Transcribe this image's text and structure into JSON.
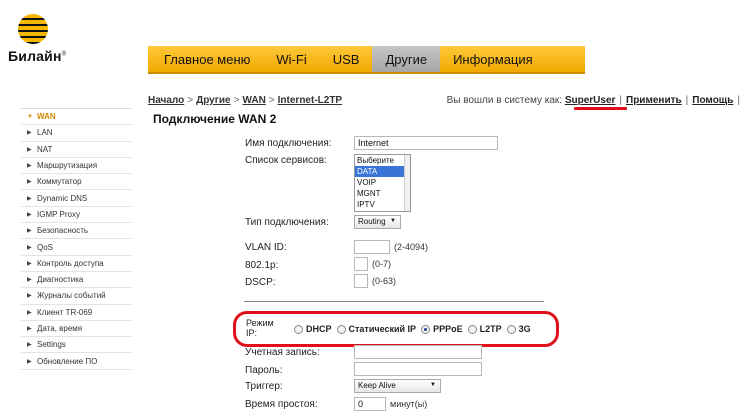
{
  "brand": {
    "logo_text": "Билайн",
    "trademark": "®"
  },
  "topnav": {
    "tabs": [
      {
        "label": "Главное меню"
      },
      {
        "label": "Wi-Fi"
      },
      {
        "label": "USB"
      },
      {
        "label": "Другие"
      },
      {
        "label": "Информация"
      }
    ],
    "active": "Другие"
  },
  "breadcrumb": [
    "Начало",
    "Другие",
    "WAN",
    "Internet-L2TP"
  ],
  "breadcrumb_sep": ">",
  "userline": {
    "prefix": "Вы вошли в систему как:",
    "user": "SuperUser",
    "apply": "Применить",
    "help": "Помощь",
    "pipe": "|"
  },
  "sidebar": {
    "items": [
      {
        "label": "WAN",
        "active": true
      },
      {
        "label": "LAN"
      },
      {
        "label": "NAT"
      },
      {
        "label": "Маршрутизация"
      },
      {
        "label": "Коммутатор"
      },
      {
        "label": "Dynamic DNS"
      },
      {
        "label": "IGMP Proxy"
      },
      {
        "label": "Безопасность"
      },
      {
        "label": "QoS"
      },
      {
        "label": "Контроль доступа"
      },
      {
        "label": "Диагностика"
      },
      {
        "label": "Журналы событий"
      },
      {
        "label": "Клиент TR-069"
      },
      {
        "label": "Дата, время"
      },
      {
        "label": "Settings"
      },
      {
        "label": "Обновление ПО"
      }
    ]
  },
  "form": {
    "title": "Подключение WAN 2",
    "connection_name": {
      "label": "Имя подключения:",
      "value": "Internet"
    },
    "services": {
      "label": "Список сервисов:",
      "options": [
        "Выберите",
        "DATA",
        "VOIP",
        "MGNT",
        "IPTV"
      ],
      "selected": "DATA"
    },
    "connection_type": {
      "label": "Тип подключения:",
      "value": "Routing"
    },
    "vlan_id": {
      "label": "VLAN ID:",
      "value": "",
      "hint": "(2-4094)"
    },
    "dot1p": {
      "label": "802.1p:",
      "value": "",
      "hint": "(0-7)"
    },
    "dscp": {
      "label": "DSCP:",
      "value": "",
      "hint": "(0-63)"
    },
    "ip_mode": {
      "label": "Режим IP:",
      "options": [
        "DHCP",
        "Статический IP",
        "PPPoE",
        "L2TP",
        "3G"
      ],
      "selected": "PPPoE"
    },
    "account": {
      "label": "Учетная запись:",
      "value": ""
    },
    "password": {
      "label": "Пароль:",
      "value": ""
    },
    "trigger": {
      "label": "Триггер:",
      "value": "Keep Alive"
    },
    "idle_time": {
      "label": "Время простоя:",
      "value": "0",
      "unit": "минут(ы)"
    }
  },
  "colors": {
    "accent": "#f5b800",
    "highlight": "#e0101a",
    "active_side": "#d08a00"
  }
}
